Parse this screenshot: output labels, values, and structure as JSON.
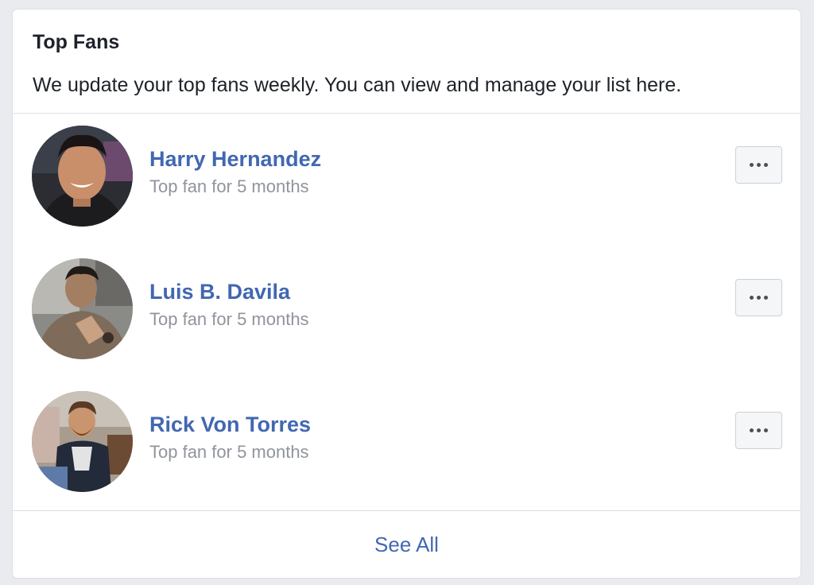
{
  "card": {
    "title": "Top Fans",
    "subtitle": "We update your top fans weekly. You can view and manage your list here."
  },
  "fans": [
    {
      "name": "Harry Hernandez",
      "meta": "Top fan for 5 months",
      "avatar": "profile-photo"
    },
    {
      "name": "Luis B. Davila",
      "meta": "Top fan for 5 months",
      "avatar": "profile-photo"
    },
    {
      "name": "Rick Von Torres",
      "meta": "Top fan for 5 months",
      "avatar": "profile-photo"
    }
  ],
  "actions": {
    "more_icon": "more-options-icon",
    "see_all": "See All"
  },
  "colors": {
    "link": "#4267b2",
    "secondary_text": "#90949c",
    "primary_text": "#1d2129",
    "page_background": "#e9ebee"
  }
}
